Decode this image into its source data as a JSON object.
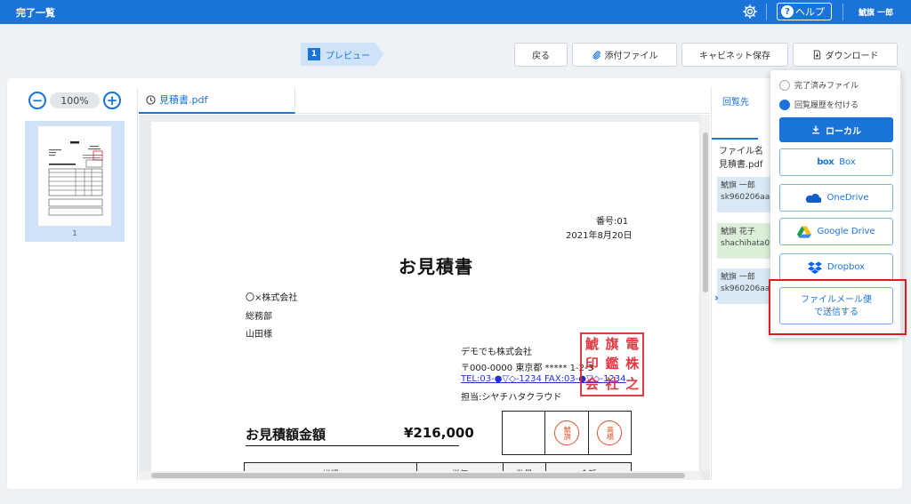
{
  "header": {
    "title": "完了一覧",
    "help_label": "ヘルプ",
    "help_glyph": "?",
    "user_name": "鯱旗 一郎"
  },
  "step": {
    "number": "1",
    "label": "プレビュー"
  },
  "actions": {
    "back": "戻る",
    "attachment": "添付ファイル",
    "cabinet_save": "キャビネット保存",
    "download": "ダウンロード"
  },
  "viewer": {
    "zoom": "100%",
    "zoom_out": "−",
    "zoom_in": "+",
    "thumbnail_page": "1",
    "tab_label": "見積書.pdf"
  },
  "document": {
    "number": "番号:01",
    "date": "2021年8月20日",
    "title": "お見積書",
    "recipient_company": "〇×株式会社",
    "recipient_dept": "総務部",
    "recipient_name": "山田様",
    "sender_company": "デモでも株式会社",
    "sender_address": "〒000-0000 東京都 ***** 1-2-3",
    "sender_tel": "TEL:03-●▽◇-1234 FAX:03-●▽◇-1234",
    "sender_contact": "担当:シヤチハタクラウド",
    "total_label": "お見積額金額",
    "total_amount": "¥216,000",
    "seal_1": "鯱旗",
    "seal_2": "高橋",
    "table_headers": [
      "詳細",
      "単価",
      "数量",
      "金額"
    ]
  },
  "right_panel": {
    "tab_label": "回覧先",
    "file_name_label": "ファイル名",
    "file_name": "見積書.pdf",
    "entries": [
      {
        "name": "鯱旗 一郎",
        "id": "sk960206aa"
      },
      {
        "name": "鯱旗 花子",
        "id": "shachihata0"
      },
      {
        "name": "鯱旗 一郎",
        "id": "sk960206aa"
      }
    ]
  },
  "download_menu": {
    "option_completed": "完了済みファイル",
    "option_history": "回覧履歴を付ける",
    "local": "ローカル",
    "box": "Box",
    "onedrive": "OneDrive",
    "google_drive": "Google Drive",
    "dropbox": "Dropbox",
    "filemail_line1": "ファイルメール便",
    "filemail_line2": "で送信する"
  },
  "colors": {
    "primary": "#1a73d9",
    "highlight": "#e01b1b",
    "seal": "#e0242e"
  }
}
